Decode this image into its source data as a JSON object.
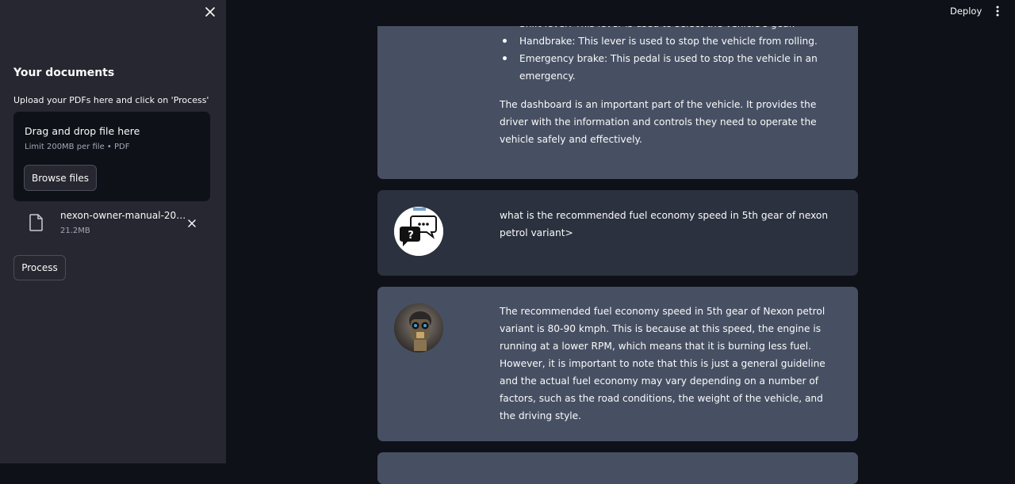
{
  "sidebar": {
    "title": "Your documents",
    "upload_label": "Upload your PDFs here and click on 'Process'",
    "dropzone": {
      "title": "Drag and drop file here",
      "limit": "Limit 200MB per file • PDF",
      "browse_label": "Browse files"
    },
    "file": {
      "name": "nexon-owner-manual-20…",
      "size": "21.2MB"
    },
    "process_label": "Process"
  },
  "header": {
    "deploy_label": "Deploy"
  },
  "chat": {
    "message1": {
      "cut_line": "Shift lever: This lever is used to select the vehicle's gear.",
      "bullets": [
        "Handbrake: This lever is used to stop the vehicle from rolling.",
        "Emergency brake: This pedal is used to stop the vehicle in an emergency."
      ],
      "paragraph": "The dashboard is an important part of the vehicle. It provides the driver with the information and controls they need to operate the vehicle safely and effectively."
    },
    "message2": {
      "text": "what is the recommended fuel economy speed in 5th gear of nexon petrol variant>"
    },
    "message3": {
      "text": "The recommended fuel economy speed in 5th gear of Nexon petrol variant is 80-90 kmph. This is because at this speed, the engine is running at a lower RPM, which means that it is burning less fuel. However, it is important to note that this is just a general guideline and the actual fuel economy may vary depending on a number of factors, such as the road conditions, the weight of the vehicle, and the driving style."
    }
  },
  "colors": {
    "sidebar_bg": "#262730",
    "main_bg": "#0e1117",
    "bot_message_bg": "#475063",
    "user_message_bg": "#2b313e"
  }
}
